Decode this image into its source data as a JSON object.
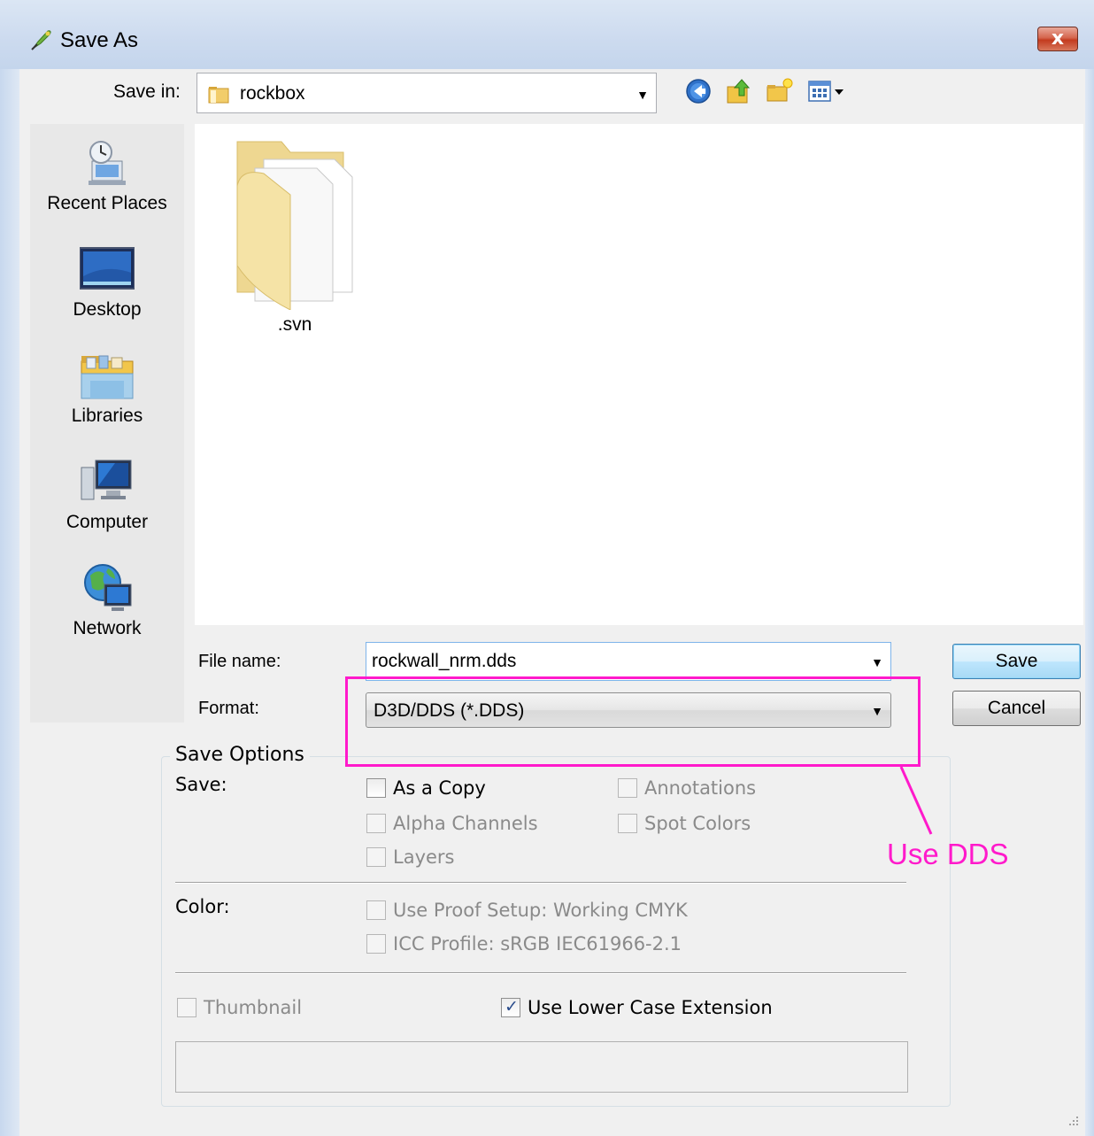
{
  "window": {
    "title": "Save As",
    "close_glyph": "x",
    "icon": "photoshop-feather-icon"
  },
  "save_in": {
    "label": "Save in:",
    "value": "rockbox",
    "toolbar_icons": [
      "back-arrow-icon",
      "up-folder-icon",
      "new-folder-icon",
      "view-menu-icon"
    ]
  },
  "places": [
    {
      "label": "Recent Places",
      "icon": "recent-places-icon"
    },
    {
      "label": "Desktop",
      "icon": "desktop-icon"
    },
    {
      "label": "Libraries",
      "icon": "libraries-icon"
    },
    {
      "label": "Computer",
      "icon": "computer-icon"
    },
    {
      "label": "Network",
      "icon": "network-icon"
    }
  ],
  "files": [
    {
      "name": ".svn",
      "icon": "folder-icon"
    }
  ],
  "file_name": {
    "label": "File name:",
    "value": "rockwall_nrm.dds"
  },
  "format": {
    "label": "Format:",
    "value": "D3D/DDS (*.DDS)"
  },
  "buttons": {
    "save": "Save",
    "cancel": "Cancel"
  },
  "save_options": {
    "title": "Save Options",
    "save_label": "Save:",
    "as_a_copy": {
      "label": "As a Copy",
      "checked": false,
      "enabled": true
    },
    "alpha_channels": {
      "label": "Alpha Channels",
      "checked": false,
      "enabled": false
    },
    "layers": {
      "label": "Layers",
      "checked": false,
      "enabled": false
    },
    "annotations": {
      "label": "Annotations",
      "checked": false,
      "enabled": false
    },
    "spot_colors": {
      "label": "Spot Colors",
      "checked": false,
      "enabled": false
    },
    "color_label": "Color:",
    "use_proof_setup": {
      "label": "Use Proof Setup:  Working CMYK",
      "checked": false,
      "enabled": false
    },
    "icc_profile": {
      "label": "ICC Profile:  sRGB IEC61966-2.1",
      "checked": false,
      "enabled": false
    },
    "thumbnail": {
      "label": "Thumbnail",
      "checked": false,
      "enabled": false
    },
    "lower_case_ext": {
      "label": "Use Lower Case Extension",
      "checked": true,
      "enabled": true
    }
  },
  "annotation": {
    "text": "Use DDS",
    "color": "#ff1acb"
  }
}
